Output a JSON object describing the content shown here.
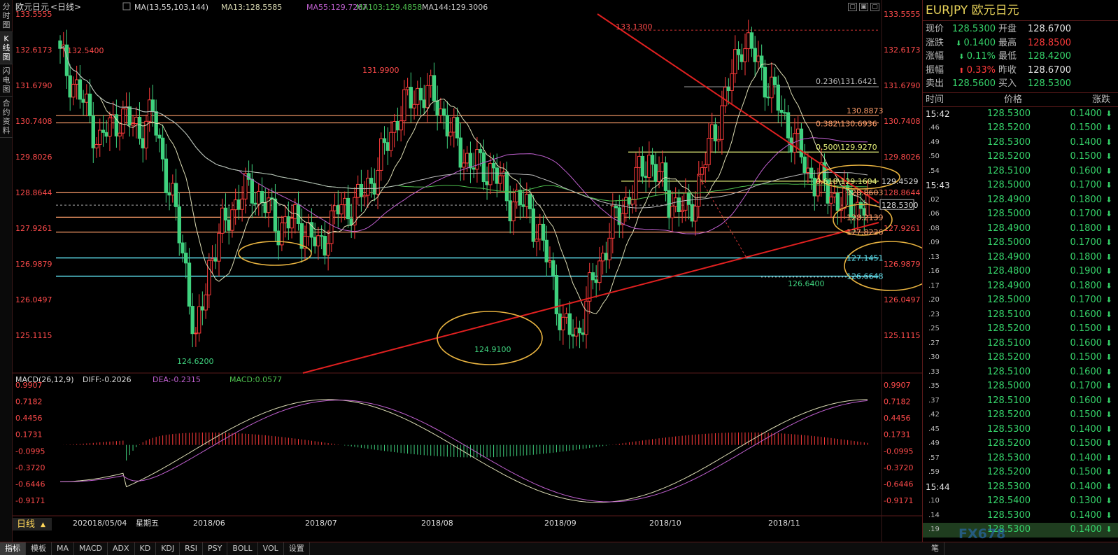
{
  "left_tabs": [
    "分时图",
    "K线图",
    "闪电图",
    "合约资料"
  ],
  "header": {
    "name": "欧元日元",
    "period": "<日线>",
    "ma_title": "MA(13,55,103,144)",
    "ma13": "MA13:128.5585",
    "ma55": "MA55:129.7267",
    "ma103": "MA103:129.4858",
    "ma144": "MA144:129.3006"
  },
  "macd_header": {
    "title": "MACD(26,12,9)",
    "diff": "DIFF:-0.2026",
    "dea": "DEA:-0.2315",
    "macd": "MACD:0.0577"
  },
  "price_axis": [
    "133.5555",
    "132.6173",
    "131.6790",
    "130.7408",
    "129.8026",
    "128.8644",
    "127.9261",
    "126.9879",
    "126.0497",
    "125.1115"
  ],
  "macd_axis": [
    "0.9907",
    "0.7182",
    "0.4456",
    "0.1731",
    "-0.0995",
    "-0.3720",
    "-0.6446",
    "-0.9171"
  ],
  "date_axis": [
    "20",
    "2018/05/04",
    "星期五",
    "2018/06",
    "2018/07",
    "2018/08",
    "2018/09",
    "2018/10",
    "2018/11"
  ],
  "period_label": "日线",
  "annotations": {
    "high_132": "132.5400",
    "high_131": "131.9900",
    "high_133": "133.1300",
    "low_124": "124.6200",
    "low_125": "124.9100",
    "low_126": "126.6400",
    "current_price": "128.5300",
    "fib": [
      "0.236\\131.6421",
      "130.8873",
      "0.382\\130.6936",
      "0.500\\129.9270",
      "0.618\\129.1604",
      "129.4529",
      "128.8603",
      "128.2139",
      "127.8226",
      "127.1451",
      "126.6648"
    ]
  },
  "right_panel": {
    "title": "EURJPY 欧元日元",
    "quote": [
      {
        "l1": "现价",
        "v1": "128.5300",
        "c1": "green",
        "l2": "开盘",
        "v2": "128.6700",
        "c2": "white"
      },
      {
        "l1": "涨跌",
        "v1": "0.1400",
        "c1": "green",
        "a1": "down",
        "l2": "最高",
        "v2": "128.8500",
        "c2": "red"
      },
      {
        "l1": "涨幅",
        "v1": "0.11%",
        "c1": "green",
        "a1": "down",
        "l2": "最低",
        "v2": "128.4200",
        "c2": "green"
      },
      {
        "l1": "振幅",
        "v1": "0.33%",
        "c1": "red",
        "a1": "up",
        "l2": "昨收",
        "v2": "128.6700",
        "c2": "white"
      },
      {
        "l1": "卖出",
        "v1": "128.5600",
        "c1": "green",
        "l2": "买入",
        "v2": "128.5300",
        "c2": "green"
      }
    ],
    "ticks_header": [
      "时间",
      "价格",
      "涨跌"
    ],
    "ticks": [
      {
        "t": "15:42",
        "p": "128.5300",
        "c": "0.1400",
        "full": true
      },
      {
        "t": ".46",
        "p": "128.5200",
        "c": "0.1500"
      },
      {
        "t": ".49",
        "p": "128.5300",
        "c": "0.1400"
      },
      {
        "t": ".50",
        "p": "128.5200",
        "c": "0.1500"
      },
      {
        "t": ".54",
        "p": "128.5100",
        "c": "0.1600"
      },
      {
        "t": "15:43",
        "p": "128.5000",
        "c": "0.1700",
        "full": true
      },
      {
        "t": ".02",
        "p": "128.4900",
        "c": "0.1800"
      },
      {
        "t": ".06",
        "p": "128.5000",
        "c": "0.1700"
      },
      {
        "t": ".08",
        "p": "128.4900",
        "c": "0.1800"
      },
      {
        "t": ".09",
        "p": "128.5000",
        "c": "0.1700"
      },
      {
        "t": ".13",
        "p": "128.4900",
        "c": "0.1800"
      },
      {
        "t": ".16",
        "p": "128.4800",
        "c": "0.1900"
      },
      {
        "t": ".17",
        "p": "128.4900",
        "c": "0.1800"
      },
      {
        "t": ".20",
        "p": "128.5000",
        "c": "0.1700"
      },
      {
        "t": ".23",
        "p": "128.5100",
        "c": "0.1600"
      },
      {
        "t": ".25",
        "p": "128.5200",
        "c": "0.1500"
      },
      {
        "t": ".27",
        "p": "128.5100",
        "c": "0.1600"
      },
      {
        "t": ".30",
        "p": "128.5200",
        "c": "0.1500"
      },
      {
        "t": ".33",
        "p": "128.5100",
        "c": "0.1600"
      },
      {
        "t": ".35",
        "p": "128.5000",
        "c": "0.1700"
      },
      {
        "t": ".37",
        "p": "128.5100",
        "c": "0.1600"
      },
      {
        "t": ".42",
        "p": "128.5200",
        "c": "0.1500"
      },
      {
        "t": ".45",
        "p": "128.5300",
        "c": "0.1400"
      },
      {
        "t": ".49",
        "p": "128.5200",
        "c": "0.1500"
      },
      {
        "t": ".57",
        "p": "128.5300",
        "c": "0.1400"
      },
      {
        "t": ".59",
        "p": "128.5200",
        "c": "0.1500"
      },
      {
        "t": "15:44",
        "p": "128.5300",
        "c": "0.1400",
        "full": true
      },
      {
        "t": ".10",
        "p": "128.5400",
        "c": "0.1300"
      },
      {
        "t": ".14",
        "p": "128.5300",
        "c": "0.1400"
      },
      {
        "t": ".19",
        "p": "128.5300",
        "c": "0.1400",
        "last": true
      }
    ]
  },
  "bottom_tabs": [
    "指标",
    "模板",
    "MA",
    "MACD",
    "ADX",
    "KD",
    "KDJ",
    "RSI",
    "PSY",
    "BOLL",
    "VOL",
    "设置"
  ],
  "bottom_right_tab": "笔",
  "watermark": "FX678",
  "colors": {
    "up": "#ff3b3b",
    "down": "#3fd27e",
    "ma13": "#dcdcb4",
    "ma55": "#c060d0",
    "ma103": "#4ec04e",
    "ma144": "#bbbbbb",
    "trend": "#e02020",
    "ellipse": "#e8b340",
    "fib_orange": "#ff9f6b",
    "fib_cyan": "#5ee0ee"
  }
}
